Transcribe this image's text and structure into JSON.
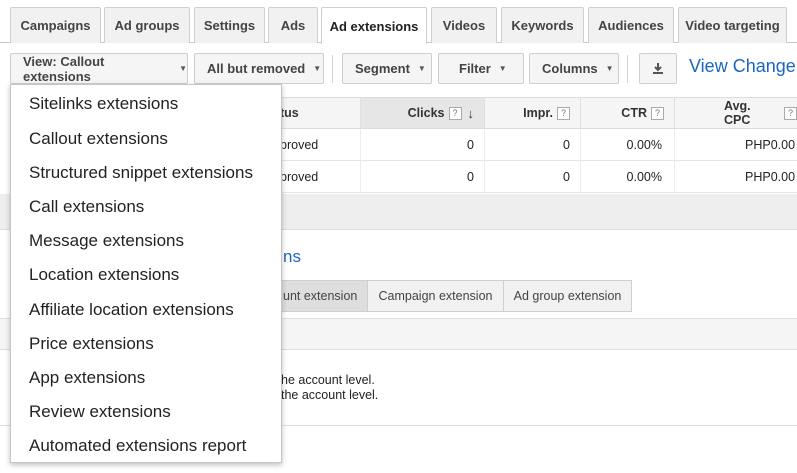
{
  "tabs": [
    {
      "label": "Campaigns"
    },
    {
      "label": "Ad groups"
    },
    {
      "label": "Settings"
    },
    {
      "label": "Ads"
    },
    {
      "label": "Ad extensions",
      "active": true
    },
    {
      "label": "Videos"
    },
    {
      "label": "Keywords"
    },
    {
      "label": "Audiences"
    },
    {
      "label": "Video targeting"
    }
  ],
  "toolbar": {
    "view_label": "View: Callout extensions",
    "status_filter_label": "All but removed",
    "segment_label": "Segment",
    "filter_label": "Filter",
    "columns_label": "Columns",
    "download_icon": "download-icon",
    "view_changes_label": "View Change"
  },
  "table": {
    "columns": {
      "status": "tus",
      "clicks": "Clicks",
      "impr": "Impr.",
      "ctr": "CTR",
      "avg_cpc": "Avg. CPC"
    },
    "help_glyph": "?",
    "sort_glyph": "↓",
    "rows": [
      {
        "status": "proved",
        "clicks": "0",
        "impr": "0",
        "ctr": "0.00%",
        "avg_cpc": "PHP0.00"
      },
      {
        "status": "proved",
        "clicks": "0",
        "impr": "0",
        "ctr": "0.00%",
        "avg_cpc": "PHP0.00"
      }
    ]
  },
  "section": {
    "title": "ns",
    "level_tabs": [
      {
        "label": "unt extension",
        "selected": true
      },
      {
        "label": "Campaign extension"
      },
      {
        "label": "Ad group extension"
      }
    ],
    "notes": [
      "he account level.",
      "the account level."
    ]
  },
  "dropdown": {
    "items": [
      "Sitelinks extensions",
      "Callout extensions",
      "Structured snippet extensions",
      "Call extensions",
      "Message extensions",
      "Location extensions",
      "Affiliate location extensions",
      "Price extensions",
      "App extensions",
      "Review extensions",
      "Automated extensions report"
    ]
  },
  "colors": {
    "link_blue": "#1a66c2",
    "tab_bg": "#f1f1f1",
    "header_bg": "#f5f5f5"
  }
}
